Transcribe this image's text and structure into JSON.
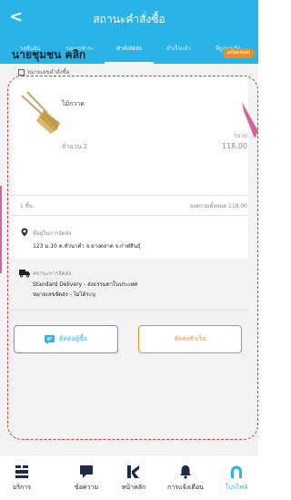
{
  "header": {
    "title": "สถานะคำสั่งซื้อ",
    "back_glyph": "<"
  },
  "tabs": [
    {
      "label": "รอยืนยัน"
    },
    {
      "label": "รอการชำระ"
    },
    {
      "label": "คำสั่งจัดส่ง"
    },
    {
      "label": "สำเร็จแล้ว"
    },
    {
      "label": "ที่ถูกยกเลิก"
    }
  ],
  "order": {
    "shop_name": "นายชุมชน คลิก",
    "status_badge": "เตรียมจัดส่ง",
    "order_number_label": "หมายเลขคำสั่งซื้อ",
    "product_name": "ไม้กวาด",
    "quantity": "จำนวน 2",
    "price_original": "59.00",
    "price": "118.00",
    "item_count": "1 ชิ้น",
    "total": "ยอดรวมทั้งหมด 118.00"
  },
  "address": {
    "label": "ที่อยู่ในการจัดส่ง",
    "text": "123 ม.10 ต.หัวนาคำ จ.ยางตลาด จ.กาฬสินธุ์"
  },
  "shipping": {
    "label": "สถานะการจัดส่ง",
    "method": "Standard Delivery - ส่งธรรมดาในประเทศ",
    "tracking": "หมายเลขจัดส่ง - ไม่ได้ระบุ"
  },
  "buttons": {
    "contact": "ติดต่อผู้ซื้อ",
    "ship": "จัดส่งสำเร็จ"
  },
  "nav": [
    {
      "label": "บริการ",
      "icon": "services-icon"
    },
    {
      "label": "ข้อความ",
      "icon": "message-icon"
    },
    {
      "label": "หน้าหลัก",
      "icon": "home-icon"
    },
    {
      "label": "การแจ้งเตือน",
      "icon": "bell-icon"
    },
    {
      "label": "โปรไฟล์",
      "icon": "profile-icon"
    }
  ],
  "colors": {
    "accent": "#29b3e6",
    "orange": "#f28c1b",
    "annotation": "#d13a3a"
  }
}
